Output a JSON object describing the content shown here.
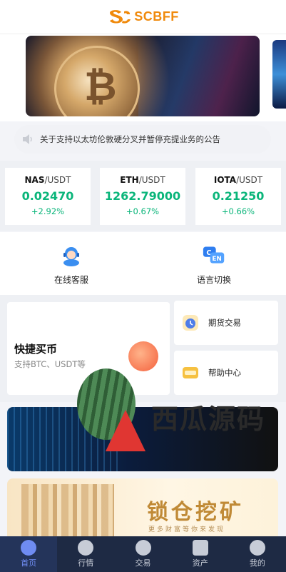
{
  "header": {
    "logo_text": "SCBFF",
    "brand_color": "#f08a0c"
  },
  "notice": {
    "text": "关于支持以太坊伦敦硬分叉并暂停充提业务的公告",
    "icon": "speaker-icon"
  },
  "tickers": [
    {
      "base": "NAS",
      "quote": "/USDT",
      "price": "0.02470",
      "change": "+2.92%"
    },
    {
      "base": "ETH",
      "quote": "/USDT",
      "price": "1262.79000",
      "change": "+0.67%"
    },
    {
      "base": "IOTA",
      "quote": "/USDT",
      "price": "0.21250",
      "change": "+0.66%"
    }
  ],
  "services": [
    {
      "label": "在线客服",
      "icon": "customer-service-icon"
    },
    {
      "label": "语言切换",
      "icon": "language-switch-icon"
    }
  ],
  "quick_buy": {
    "title": "快捷买币",
    "subtitle": "支持BTC、USDT等"
  },
  "side_cards": [
    {
      "label": "期货交易",
      "icon": "futures-icon"
    },
    {
      "label": "帮助中心",
      "icon": "help-center-icon"
    }
  ],
  "watermark": {
    "text": "西瓜源码"
  },
  "promo2": {
    "title": "锁仓挖矿",
    "subtitle": "更多财富等你来发现"
  },
  "tabbar": [
    {
      "label": "首页",
      "icon": "home-icon",
      "active": true
    },
    {
      "label": "行情",
      "icon": "market-icon",
      "active": false
    },
    {
      "label": "交易",
      "icon": "trade-icon",
      "active": false
    },
    {
      "label": "资产",
      "icon": "wallet-icon",
      "active": false
    },
    {
      "label": "我的",
      "icon": "user-icon",
      "active": false
    }
  ],
  "colors": {
    "up": "#0ab57a",
    "tab_active": "#6f8cf2",
    "tabbar_bg": "#1e2a44"
  }
}
